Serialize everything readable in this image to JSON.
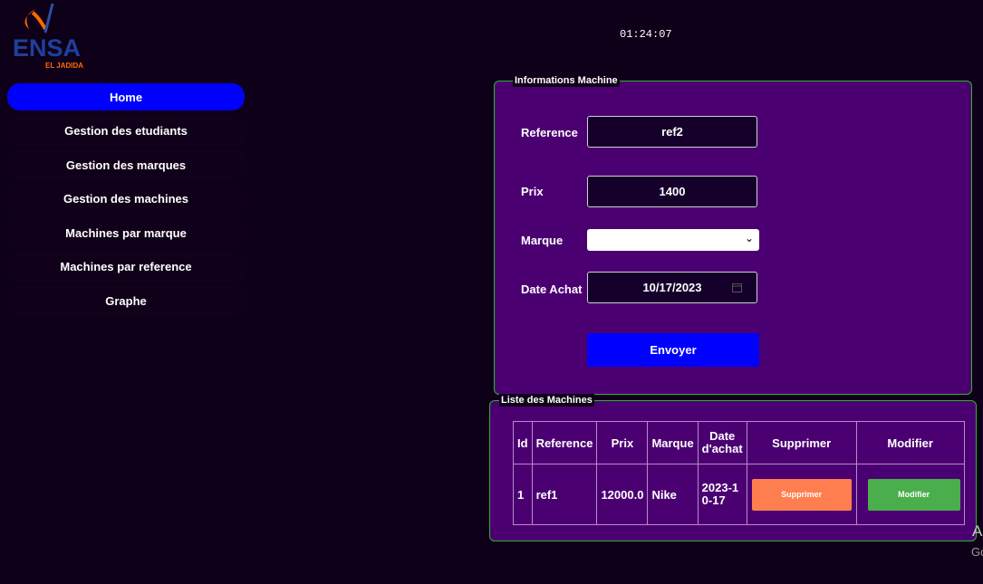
{
  "logo": {
    "main": "ENSA",
    "sub": "EL JADIDA"
  },
  "clock": "01:24:07",
  "sidebar": {
    "items": [
      {
        "label": "Home",
        "active": true
      },
      {
        "label": "Gestion des etudiants"
      },
      {
        "label": "Gestion des marques"
      },
      {
        "label": "Gestion des machines"
      },
      {
        "label": "Machines par marque"
      },
      {
        "label": "Machines par reference"
      },
      {
        "label": "Graphe"
      }
    ]
  },
  "form": {
    "legend": "Informations Machine",
    "reference_label": "Reference",
    "reference_value": "ref2",
    "prix_label": "Prix",
    "prix_value": "1400",
    "marque_label": "Marque",
    "marque_value": "",
    "date_label": "Date Achat",
    "date_value": "10/17/2023",
    "submit_label": "Envoyer"
  },
  "table": {
    "legend": "Liste des Machines",
    "headers": [
      "Id",
      "Reference",
      "Prix",
      "Marque",
      "Date d'achat",
      "Supprimer",
      "Modifier"
    ],
    "rows": [
      {
        "id": "1",
        "reference": "ref1",
        "prix": "12000.0",
        "marque": "Nike",
        "date": "2023-10-17",
        "delete_label": "Supprimer",
        "edit_label": "Modifier"
      }
    ]
  },
  "edge_text": {
    "a": "A",
    "g": "Go"
  },
  "colors": {
    "background": "#0e0018",
    "panel": "#4b0072",
    "active_nav": "#0000ff",
    "submit": "#0000ff",
    "delete": "#ff7e4f",
    "edit": "#49ae4b",
    "panel_border": "#2fb02f"
  }
}
